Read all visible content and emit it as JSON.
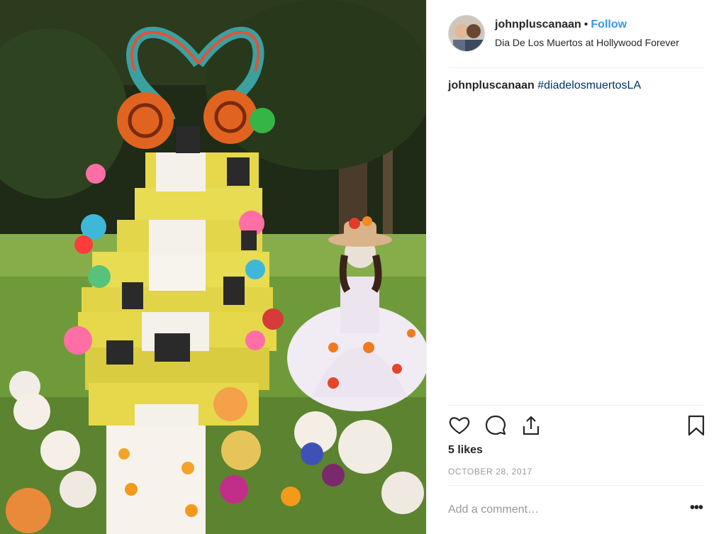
{
  "post": {
    "image_alt": "Dia de los Muertos altar with sugar skulls and a woman in a white dress with butterfly decorations",
    "image_icon": "photo"
  },
  "header": {
    "avatar_icon": "profile-avatar",
    "username": "johnpluscanaan",
    "separator": "•",
    "follow_label": "Follow",
    "location": "Dia De Los Muertos at Hollywood Forever"
  },
  "caption": {
    "username": "johnpluscanaan",
    "hashtag": "#diadelosmuertosLA"
  },
  "actions": {
    "like_icon": "heart-icon",
    "comment_icon": "comment-icon",
    "share_icon": "share-icon",
    "save_icon": "bookmark-icon"
  },
  "likes": "5 likes",
  "date": "OCTOBER 28, 2017",
  "comment": {
    "placeholder": "Add a comment…",
    "more_label": "•••"
  },
  "colors": {
    "follow": "#3897f0",
    "hashtag": "#003569",
    "muted": "#999999",
    "text": "#262626"
  }
}
